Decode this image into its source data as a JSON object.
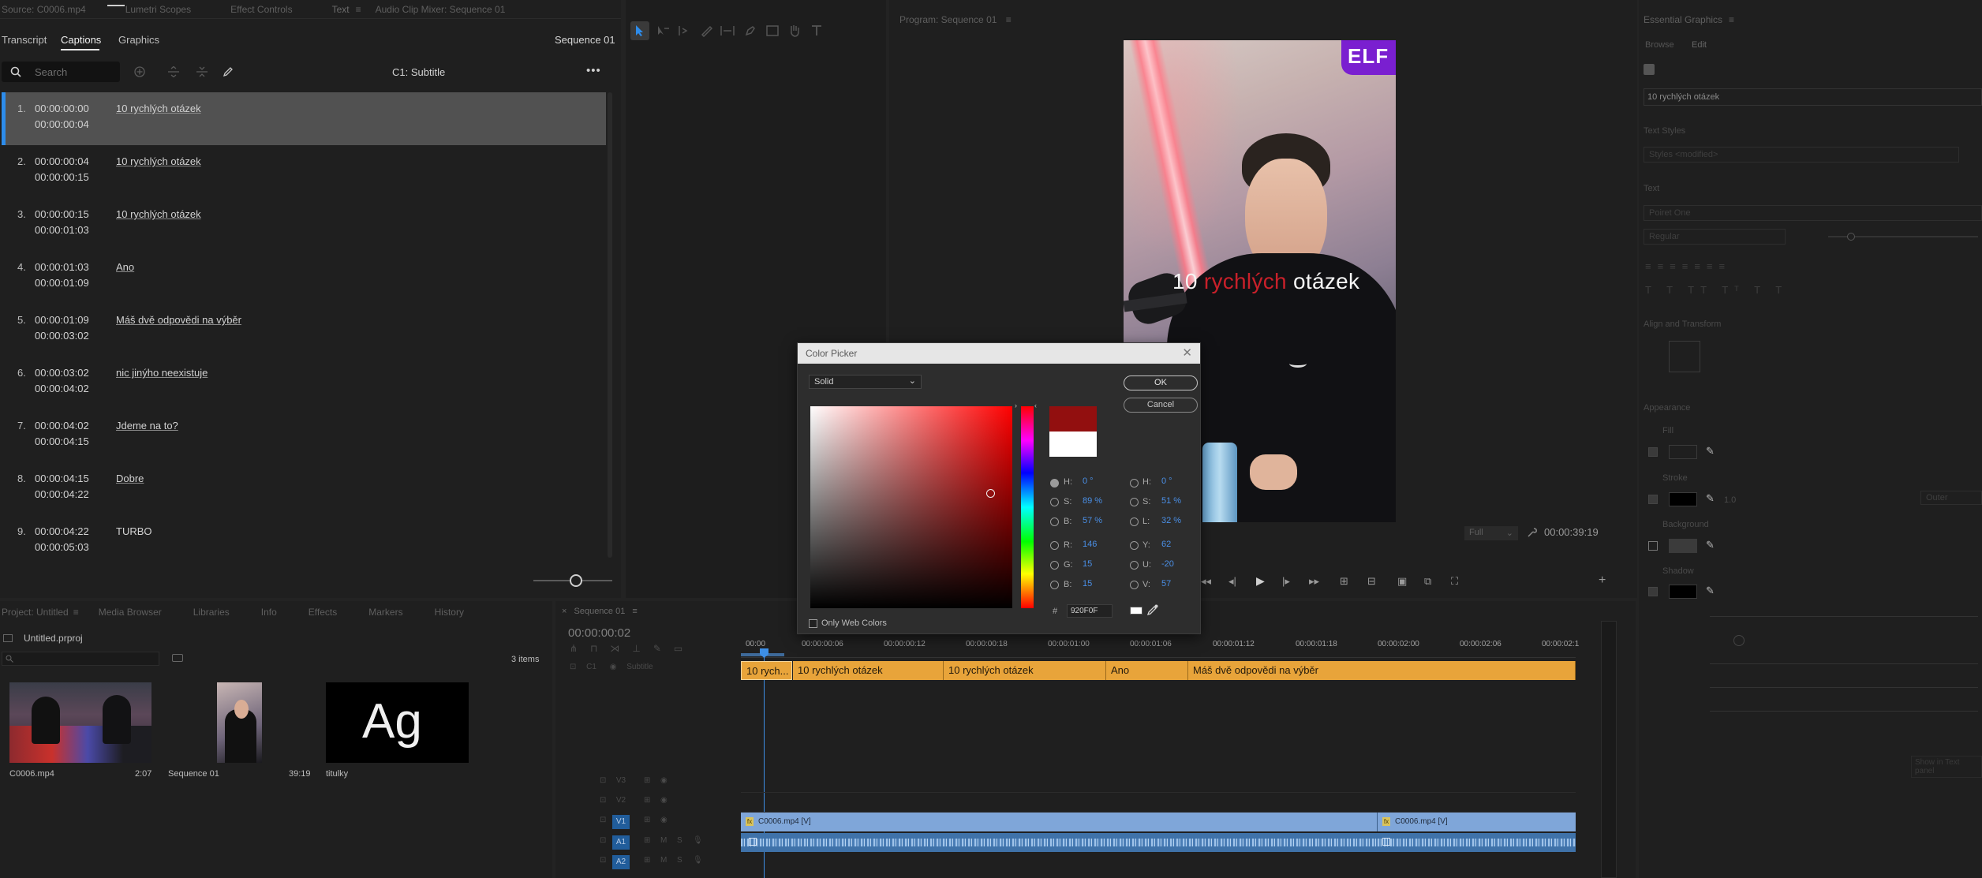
{
  "top_tabs": {
    "source": "Source: C0006.mp4",
    "lumetri": "Lumetri Scopes",
    "effect_controls": "Effect Controls",
    "text": "Text",
    "audio_mixer": "Audio Clip Mixer: Sequence 01"
  },
  "text_panel": {
    "tabs": [
      "Transcript",
      "Captions",
      "Graphics"
    ],
    "active_tab": "Captions",
    "sequence_name": "Sequence 01",
    "search_placeholder": "Search",
    "track_name": "C1: Subtitle",
    "more": "•••"
  },
  "captions": [
    {
      "num": "1.",
      "start": "00:00:00:00",
      "end": "00:00:00:04",
      "text": "10 rychlých otázek",
      "selected": true
    },
    {
      "num": "2.",
      "start": "00:00:00:04",
      "end": "00:00:00:15",
      "text": "10 rychlých otázek"
    },
    {
      "num": "3.",
      "start": "00:00:00:15",
      "end": "00:00:01:03",
      "text": "10 rychlých otázek"
    },
    {
      "num": "4.",
      "start": "00:00:01:03",
      "end": "00:00:01:09",
      "text": "Ano"
    },
    {
      "num": "5.",
      "start": "00:00:01:09",
      "end": "00:00:03:02",
      "text": "Máš dvě odpovědi na výběr"
    },
    {
      "num": "6.",
      "start": "00:00:03:02",
      "end": "00:00:04:02",
      "text": "nic jinýho neexistuje"
    },
    {
      "num": "7.",
      "start": "00:00:04:02",
      "end": "00:00:04:15",
      "text": "Jdeme na to?"
    },
    {
      "num": "8.",
      "start": "00:00:04:15",
      "end": "00:00:04:22",
      "text": "Dobre"
    },
    {
      "num": "9.",
      "start": "00:00:04:22",
      "end": "00:00:05:03",
      "text": "TURBO"
    }
  ],
  "program": {
    "title": "Program: Sequence 01",
    "overlay_text_before": "10 ",
    "overlay_text_highlight": "rychlých",
    "overlay_text_after": " otázek",
    "logo_text": "ELF",
    "fit": "Full",
    "timecode": "00:00:39:19"
  },
  "project": {
    "tabs": [
      "Project: Untitled",
      "Media Browser",
      "Libraries",
      "Info",
      "Effects",
      "Markers",
      "History"
    ],
    "file": "Untitled.prproj",
    "items_count": "3 items",
    "items": [
      {
        "name": "C0006.mp4",
        "duration": "2:07"
      },
      {
        "name": "Sequence 01",
        "duration": "39:19"
      },
      {
        "name": "titulky",
        "duration": ""
      }
    ],
    "graphic_thumb_text": "Ag"
  },
  "timeline": {
    "tab": "Sequence 01",
    "timecode": "00:00:00:02",
    "ruler": [
      "00:00",
      "00:00:00:06",
      "00:00:00:12",
      "00:00:00:18",
      "00:00:01:00",
      "00:00:01:06",
      "00:00:01:12",
      "00:00:01:18",
      "00:00:02:00",
      "00:00:02:06",
      "00:00:02:1"
    ],
    "caption_track": "Subtitle",
    "caption_clips": [
      "10 rych...",
      "10 rychlých otázek",
      "10 rychlých otázek",
      "Ano",
      "Máš dvě odpovědi na výběr"
    ],
    "tracks": [
      "V3",
      "V2",
      "V1",
      "A1",
      "A2"
    ],
    "video_clips": [
      "C0006.mp4 [V]",
      "C0006.mp4 [V]"
    ],
    "fx": "fx"
  },
  "color_picker": {
    "title": "Color Picker",
    "fill_type": "Solid",
    "ok": "OK",
    "cancel": "Cancel",
    "hsb": {
      "h_label": "H:",
      "h": "0 °",
      "s_label": "S:",
      "s": "89 %",
      "b_label": "B:",
      "b": "57 %"
    },
    "rgb": {
      "r_label": "R:",
      "r": "146",
      "g_label": "G:",
      "g": "15",
      "b_label": "B:",
      "b": "15"
    },
    "hsl": {
      "h_label": "H:",
      "h": "0 °",
      "s_label": "S:",
      "s": "51 %",
      "l_label": "L:",
      "l": "32 %"
    },
    "yuv": {
      "y_label": "Y:",
      "y": "62",
      "u_label": "U:",
      "u": "-20",
      "v_label": "V:",
      "v": "57"
    },
    "hex_label": "#",
    "hex": "920F0F",
    "only_web_colors": "Only Web Colors",
    "new_color": "#920F0F",
    "old_color": "#FFFFFF"
  },
  "essential_graphics": {
    "title": "Essential Graphics",
    "tabs": [
      "Browse",
      "Edit"
    ],
    "layer_name": "10 rychlých otázek",
    "text_style_label": "Text Styles",
    "style_value": "Styles <modified>",
    "font_label": "Text",
    "font": "Poiret One",
    "font_style": "Regular",
    "align_label": "Align and Transform",
    "appearance": "Appearance",
    "fill": "Fill",
    "stroke": "Stroke",
    "background": "Background",
    "shadow": "Shadow",
    "outer": "Outer",
    "stroke_value": "1.0",
    "show_in_text_panel": "Show in Text panel"
  },
  "colors": {
    "accent": "#2d8ceb",
    "caption_clip": "#e8a43a",
    "video_clip": "#7fa6d9",
    "highlight_red": "#c8202a"
  }
}
